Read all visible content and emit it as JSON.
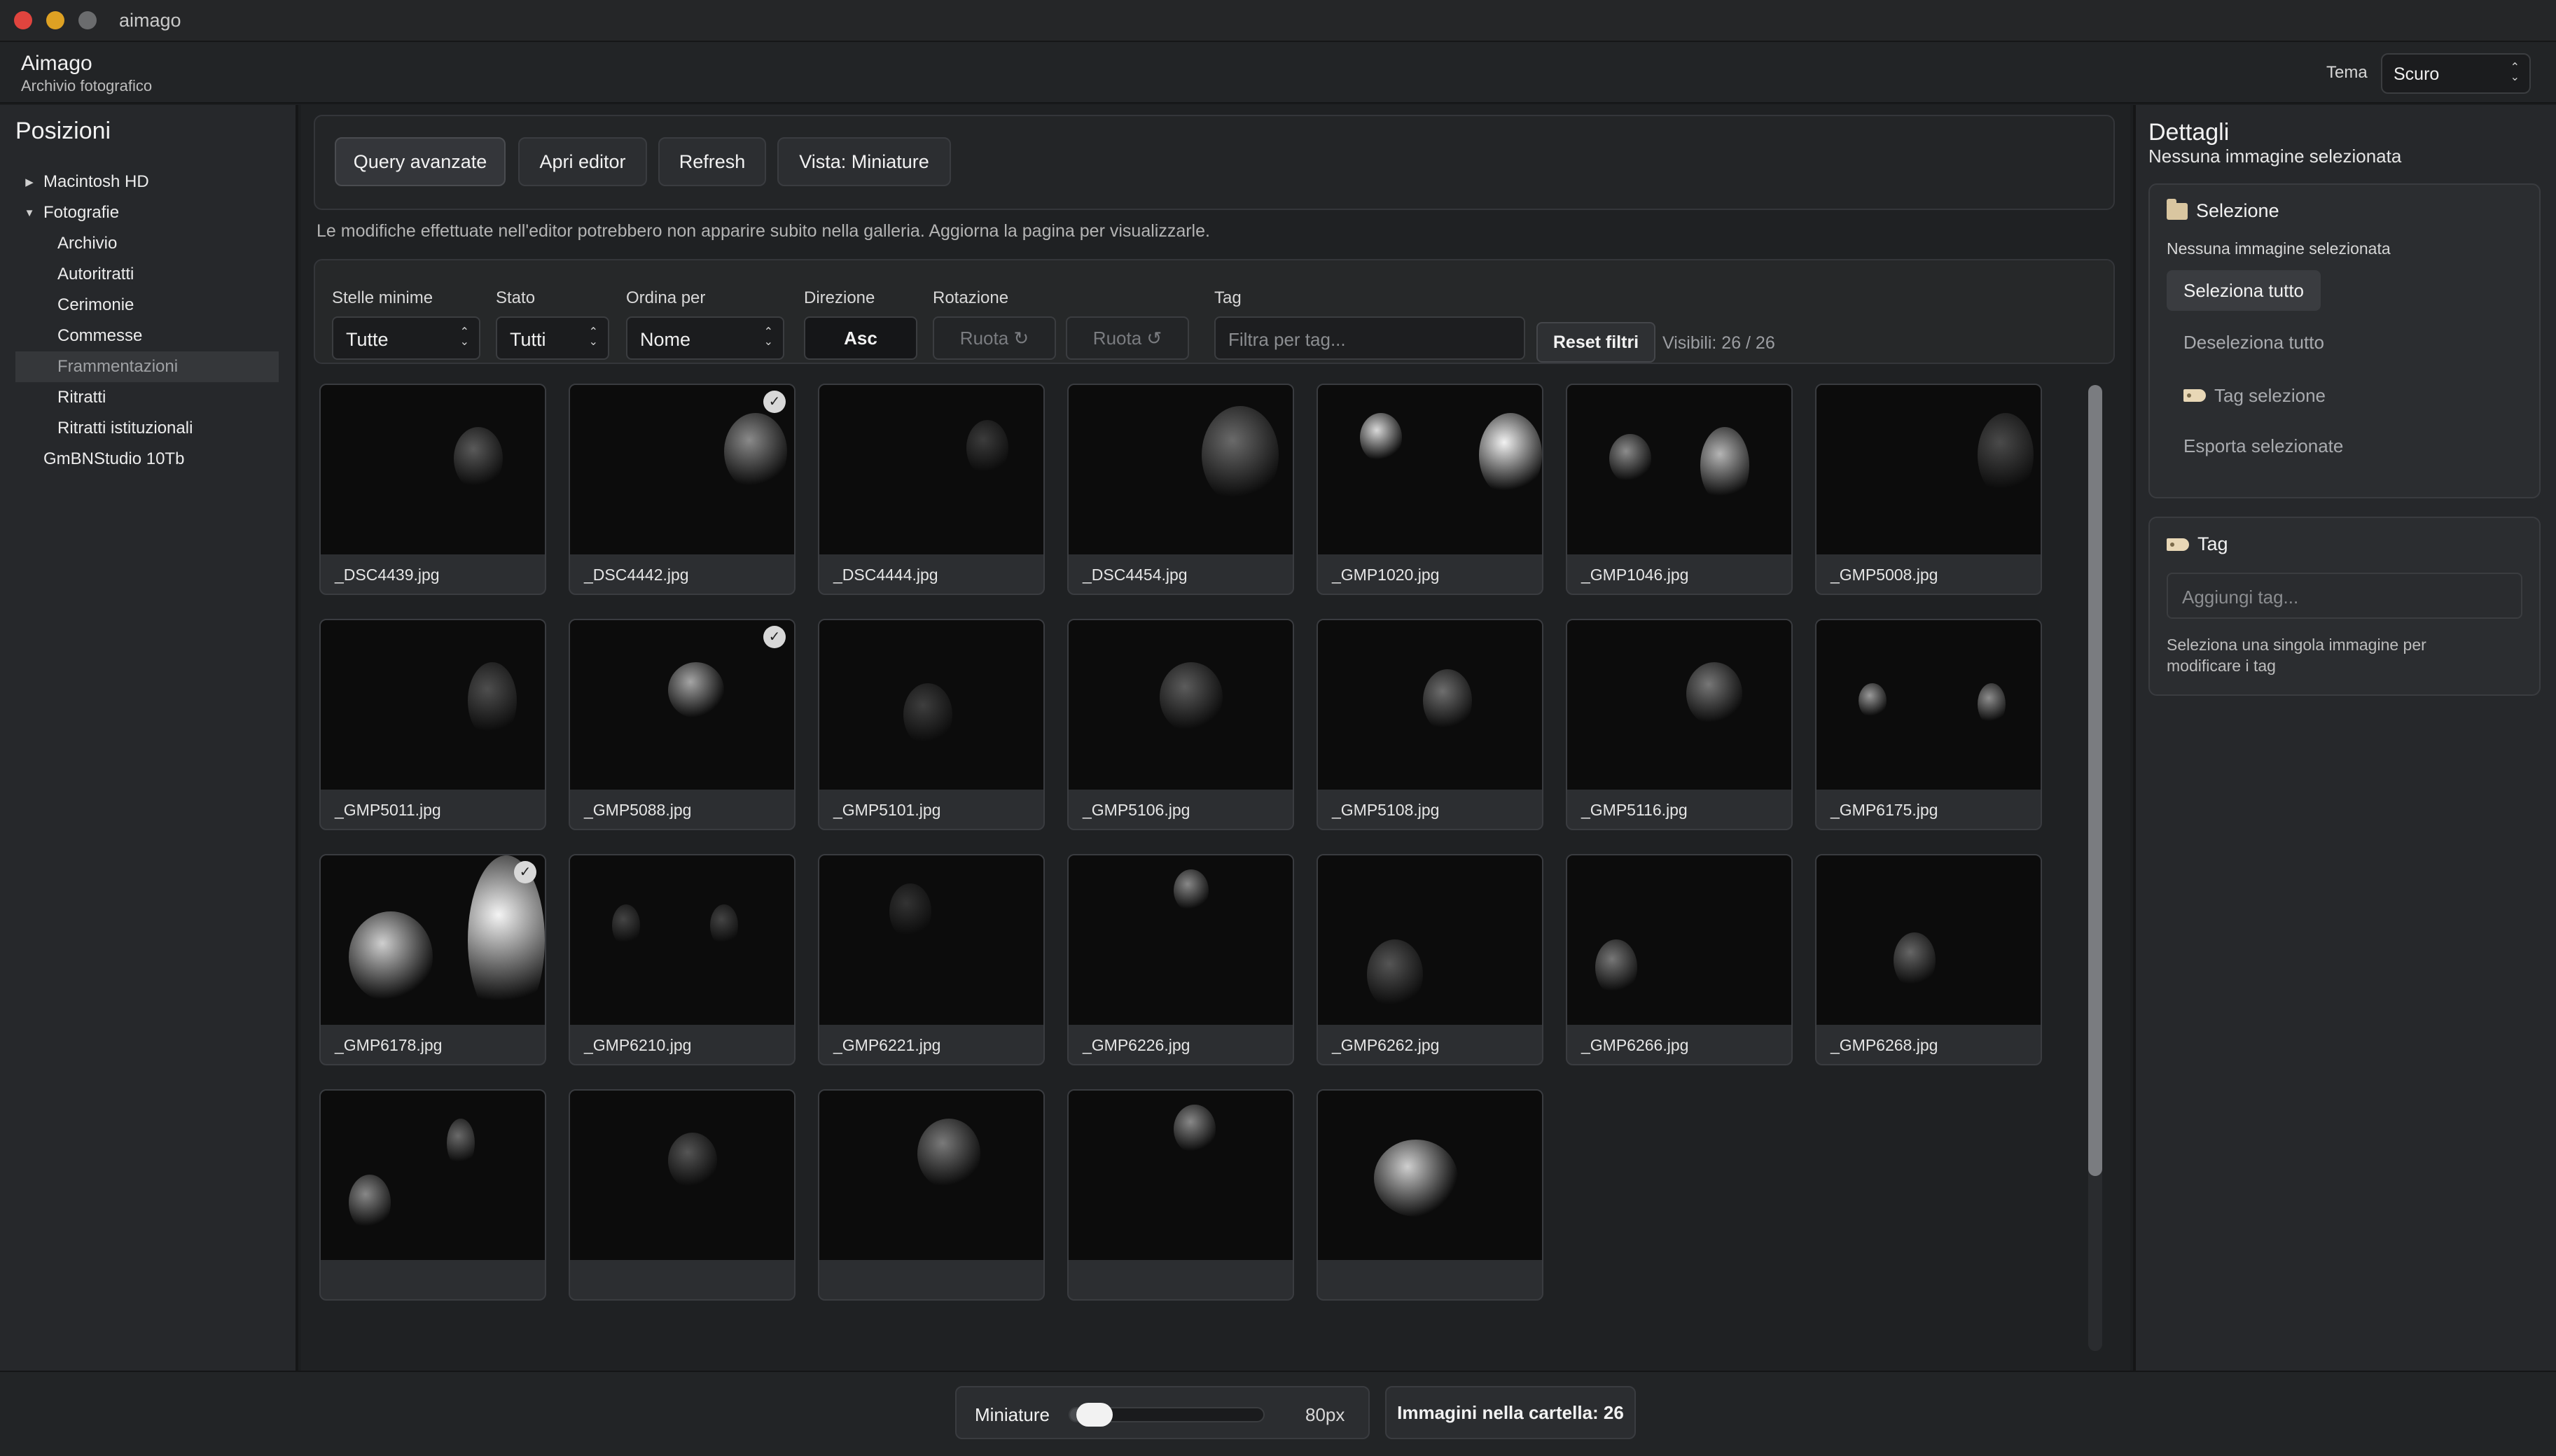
{
  "window": {
    "title": "aimago"
  },
  "app": {
    "name": "Aimago",
    "subtitle": "Archivio fotografico",
    "theme_label": "Tema",
    "theme_value": "Scuro"
  },
  "colors": {
    "traffic_red": "#e0443e",
    "traffic_yellow": "#dea123",
    "traffic_gray": "#6b6c6e",
    "accent": "#3a3c40",
    "background": "#1c1e20"
  },
  "sidebar": {
    "title": "Posizioni",
    "items": [
      {
        "label": "Macintosh HD",
        "twisty": "▶"
      },
      {
        "label": "Fotografie",
        "twisty": "▼"
      },
      {
        "label": "Archivio",
        "twisty": ""
      },
      {
        "label": "Autoritratti",
        "twisty": ""
      },
      {
        "label": "Cerimonie",
        "twisty": ""
      },
      {
        "label": "Commesse",
        "twisty": ""
      },
      {
        "label": "Frammentazioni",
        "twisty": "",
        "selected": true
      },
      {
        "label": "Ritratti",
        "twisty": ""
      },
      {
        "label": "Ritratti istituzionali",
        "twisty": ""
      },
      {
        "label": "GmBNStudio 10Tb",
        "twisty": ""
      }
    ]
  },
  "toolbar": {
    "query_label": "Query avanzate",
    "editor_label": "Apri editor",
    "refresh_label": "Refresh",
    "view_label": "Vista: Miniature"
  },
  "notice": "Le modifiche effettuate nell'editor potrebbero non apparire subito nella galleria. Aggiorna la pagina per visualizzarle.",
  "filters": {
    "stars_label": "Stelle minime",
    "stars_value": "Tutte",
    "status_label": "Stato",
    "status_value": "Tutti",
    "sort_label": "Ordina per",
    "sort_value": "Nome",
    "direction_label": "Direzione",
    "direction_value": "Asc",
    "rotation_label": "Rotazione",
    "rotate_cw": "Ruota ↻",
    "rotate_ccw": "Ruota ↺",
    "tag_label": "Tag",
    "tag_placeholder": "Filtra per tag...",
    "reset_label": "Reset filtri",
    "visible_count": "Visibili: 26 / 26"
  },
  "gallery": {
    "thumbnails": [
      {
        "name": "_DSC4439.jpg",
        "checked": false
      },
      {
        "name": "_DSC4442.jpg",
        "checked": true
      },
      {
        "name": "_DSC4444.jpg",
        "checked": false
      },
      {
        "name": "_DSC4454.jpg",
        "checked": false
      },
      {
        "name": "_GMP1020.jpg",
        "checked": false
      },
      {
        "name": "_GMP1046.jpg",
        "checked": false
      },
      {
        "name": "_GMP5008.jpg",
        "checked": false
      },
      {
        "name": "_GMP5011.jpg",
        "checked": false
      },
      {
        "name": "_GMP5088.jpg",
        "checked": true
      },
      {
        "name": "_GMP5101.jpg",
        "checked": false
      },
      {
        "name": "_GMP5106.jpg",
        "checked": false
      },
      {
        "name": "_GMP5108.jpg",
        "checked": false
      },
      {
        "name": "_GMP5116.jpg",
        "checked": false
      },
      {
        "name": "_GMP6175.jpg",
        "checked": false
      },
      {
        "name": "_GMP6178.jpg",
        "checked": true
      },
      {
        "name": "_GMP6210.jpg",
        "checked": false
      },
      {
        "name": "_GMP6221.jpg",
        "checked": false
      },
      {
        "name": "_GMP6226.jpg",
        "checked": false
      },
      {
        "name": "_GMP6262.jpg",
        "checked": false
      },
      {
        "name": "_GMP6266.jpg",
        "checked": false
      },
      {
        "name": "_GMP6268.jpg",
        "checked": false
      },
      {
        "name": "",
        "checked": false
      },
      {
        "name": "",
        "checked": false
      },
      {
        "name": "",
        "checked": false
      },
      {
        "name": "",
        "checked": false
      },
      {
        "name": "",
        "checked": false
      }
    ]
  },
  "details": {
    "title": "Dettagli",
    "subtitle": "Nessuna immagine selezionata",
    "selection": {
      "title": "Selezione",
      "status": "Nessuna immagine selezionata",
      "select_all": "Seleziona tutto",
      "deselect_all": "Deseleziona tutto",
      "tag_selection": "Tag selezione",
      "export_selected": "Esporta selezionate"
    },
    "tags": {
      "title": "Tag",
      "placeholder": "Aggiungi tag...",
      "hint": "Seleziona una singola immagine per modificare i tag"
    }
  },
  "footer": {
    "thumb_label": "Miniature",
    "thumb_size": "80px",
    "thumb_size_level": 0.05,
    "folder_count": "Immagini nella cartella: 26"
  }
}
